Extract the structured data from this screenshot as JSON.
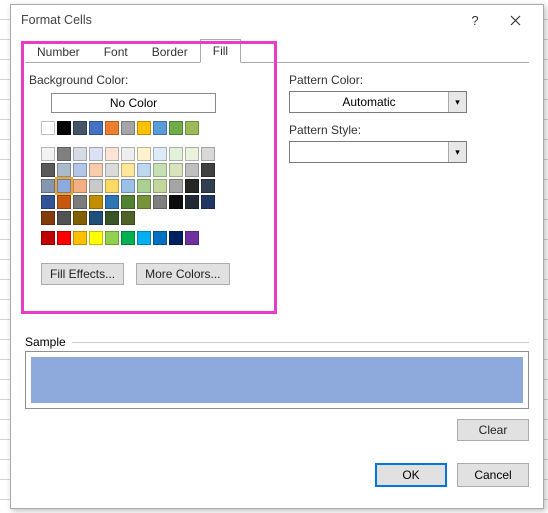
{
  "dialog": {
    "title": "Format Cells",
    "help_tooltip": "?",
    "close_tooltip": "×"
  },
  "tabs": {
    "items": [
      {
        "label": "Number",
        "active": false
      },
      {
        "label": "Font",
        "active": false
      },
      {
        "label": "Border",
        "active": false
      },
      {
        "label": "Fill",
        "active": true
      }
    ]
  },
  "fill": {
    "bg_label": "Background Color:",
    "no_color": "No Color",
    "fill_effects": "Fill Effects...",
    "more_colors": "More Colors...",
    "theme_colors": [
      "#ffffff",
      "#000000",
      "#44546a",
      "#4472c4",
      "#ed7d31",
      "#a5a5a5",
      "#ffc000",
      "#5b9bd5",
      "#70ad47",
      "#9bbb59"
    ],
    "theme_shades": [
      [
        "#f2f2f2",
        "#808080",
        "#d5dce4",
        "#d9e1f2",
        "#fce4d6",
        "#ededed",
        "#fff2cc",
        "#ddebf7",
        "#e2efda",
        "#eaf1dd"
      ],
      [
        "#d8d8d8",
        "#595959",
        "#acb9ca",
        "#b4c6e7",
        "#f8cbad",
        "#dbdbdb",
        "#ffe699",
        "#bdd7ee",
        "#c6e0b4",
        "#d7e4bc"
      ],
      [
        "#bfbfbf",
        "#404040",
        "#8496b0",
        "#8ea9db",
        "#f4b084",
        "#c9c9c9",
        "#ffd966",
        "#9bc2e6",
        "#a9d08e",
        "#c3d69b"
      ],
      [
        "#a5a5a5",
        "#262626",
        "#333f4f",
        "#305496",
        "#c65911",
        "#7b7b7b",
        "#bf8f00",
        "#2f75b5",
        "#548235",
        "#76933c"
      ],
      [
        "#7f7f7f",
        "#0c0c0c",
        "#222b35",
        "#203764",
        "#833c0c",
        "#525252",
        "#806000",
        "#1f4e78",
        "#375623",
        "#4f6228"
      ]
    ],
    "standard_colors": [
      "#c00000",
      "#ff0000",
      "#ffc000",
      "#ffff00",
      "#92d050",
      "#00b050",
      "#00b0f0",
      "#0070c0",
      "#002060",
      "#7030a0"
    ],
    "selected_color": "#8ea9db"
  },
  "pattern": {
    "color_label": "Pattern Color:",
    "color_value": "Automatic",
    "style_label": "Pattern Style:",
    "style_value": ""
  },
  "sample": {
    "label": "Sample",
    "color": "#8ea9db"
  },
  "buttons": {
    "clear": "Clear",
    "ok": "OK",
    "cancel": "Cancel"
  }
}
